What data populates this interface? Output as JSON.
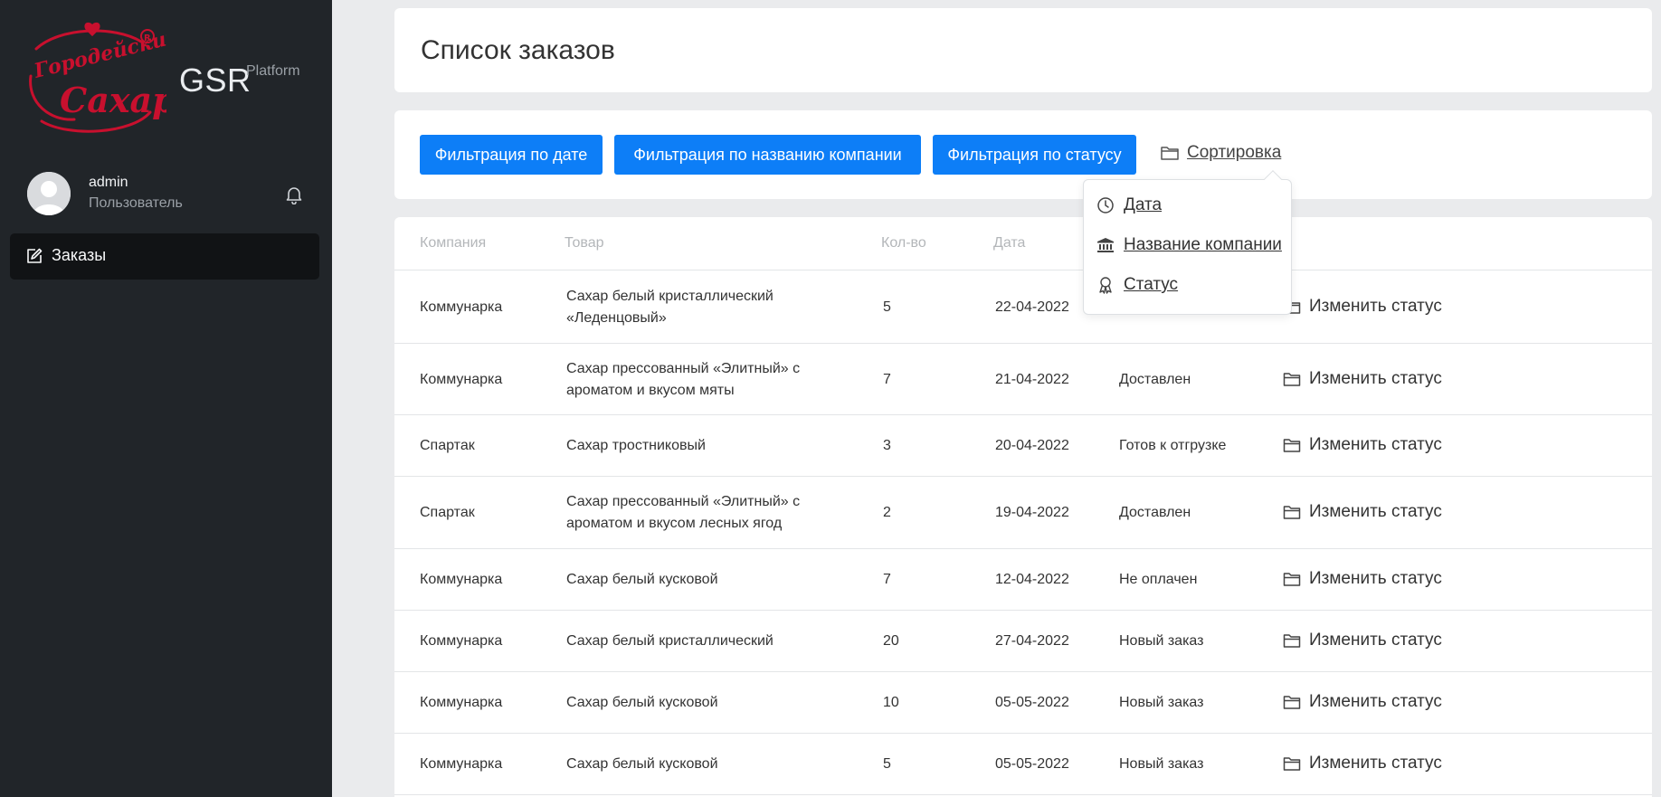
{
  "brand": {
    "name": "GSR",
    "sub": "Platform",
    "logo_text": "Городейский Сахар"
  },
  "user": {
    "name": "admin",
    "role": "Пользователь"
  },
  "nav": {
    "orders": "Заказы"
  },
  "page": {
    "title": "Список заказов"
  },
  "filters": {
    "by_date": "Фильтрация по дате",
    "by_company": "Фильтрация по названию компании",
    "by_status": "Фильтрация по статусу",
    "sort_label": "Сортировка"
  },
  "sort_menu": {
    "items": [
      {
        "label": "Дата",
        "icon": "clock-icon"
      },
      {
        "label": "Название компании",
        "icon": "bank-icon"
      },
      {
        "label": "Статус",
        "icon": "award-icon"
      }
    ]
  },
  "table": {
    "headers": {
      "company": "Компания",
      "product": "Товар",
      "qty": "Кол-во",
      "date": "Дата"
    },
    "rows": [
      {
        "company": "Коммунарка",
        "product": "Сахар белый кристаллический «Леденцовый»",
        "qty": "5",
        "date": "22-04-2022",
        "status": "",
        "action": "Изменить статус"
      },
      {
        "company": "Коммунарка",
        "product": "Сахар прессованный «Элитный» с ароматом и вкусом мяты",
        "qty": "7",
        "date": "21-04-2022",
        "status": "Доставлен",
        "action": "Изменить статус"
      },
      {
        "company": "Спартак",
        "product": "Сахар тростниковый",
        "qty": "3",
        "date": "20-04-2022",
        "status": "Готов к отгрузке",
        "action": "Изменить статус"
      },
      {
        "company": "Спартак",
        "product": "Сахар прессованный «Элитный» с ароматом и вкусом лесных ягод",
        "qty": "2",
        "date": "19-04-2022",
        "status": "Доставлен",
        "action": "Изменить статус"
      },
      {
        "company": "Коммунарка",
        "product": "Сахар белый кусковой",
        "qty": "7",
        "date": "12-04-2022",
        "status": "Не оплачен",
        "action": "Изменить статус"
      },
      {
        "company": "Коммунарка",
        "product": "Сахар белый кристаллический",
        "qty": "20",
        "date": "27-04-2022",
        "status": "Новый заказ",
        "action": "Изменить статус"
      },
      {
        "company": "Коммунарка",
        "product": "Сахар белый кусковой",
        "qty": "10",
        "date": "05-05-2022",
        "status": "Новый заказ",
        "action": "Изменить статус"
      },
      {
        "company": "Коммунарка",
        "product": "Сахар белый кусковой",
        "qty": "5",
        "date": "05-05-2022",
        "status": "Новый заказ",
        "action": "Изменить статус"
      }
    ]
  },
  "colors": {
    "sidebar": "#212529",
    "primary": "#0d7ef7",
    "logo": "#c8102e"
  }
}
